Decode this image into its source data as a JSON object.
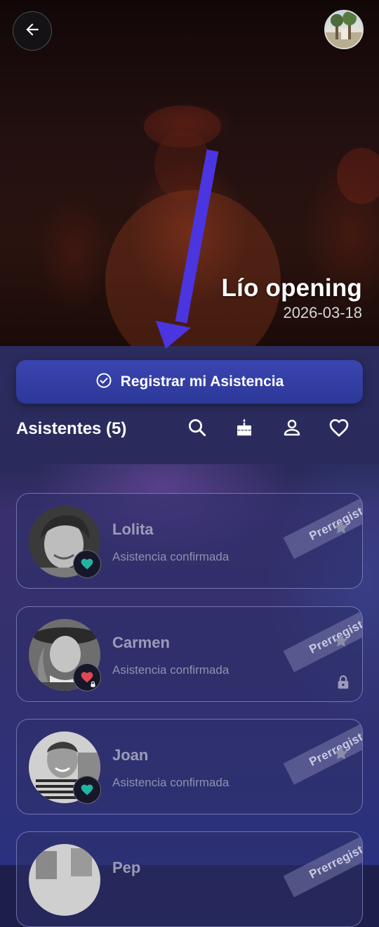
{
  "event": {
    "title": "Lío opening",
    "date": "2026-03-18"
  },
  "actions": {
    "register_label": "Registrar mi Asistencia"
  },
  "attendees": {
    "title": "Asistentes (5)",
    "list": [
      {
        "name": "Lolita",
        "status": "Asistencia confirmada",
        "tag": "Prerregistro",
        "heart_color": "#22b5a0",
        "locked": false
      },
      {
        "name": "Carmen",
        "status": "Asistencia confirmada",
        "tag": "Prerregistro",
        "heart_color": "#e2474f",
        "locked": true
      },
      {
        "name": "Joan",
        "status": "Asistencia confirmada",
        "tag": "Prerregistro",
        "heart_color": "#22b5a0",
        "locked": false
      },
      {
        "name": "Pep",
        "status": "",
        "tag": "Prerregistro",
        "heart_color": "#22b5a0",
        "locked": false
      }
    ]
  },
  "icons": {
    "back": "arrow-left-icon",
    "search": "search-icon",
    "birthday": "cake-icon",
    "profile": "person-icon",
    "favorites": "heart-outline-icon"
  },
  "colors": {
    "accent": "#3a45b0",
    "annotation_arrow": "#4b35e0"
  }
}
